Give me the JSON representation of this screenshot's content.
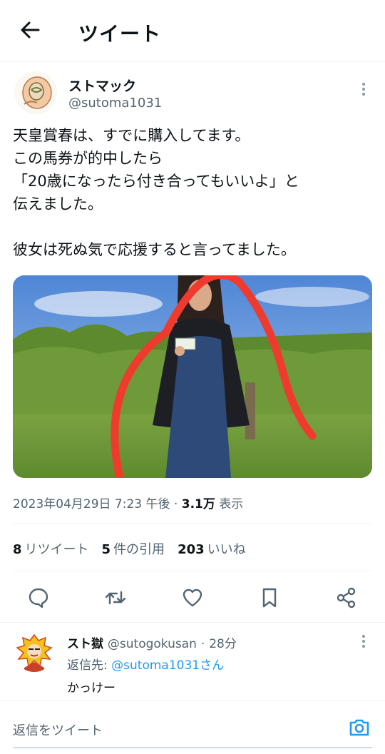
{
  "header": {
    "title": "ツイート"
  },
  "tweet": {
    "display_name": "ストマック",
    "handle": "@sutoma1031",
    "text": "天皇賞春は、すでに購入してます。\nこの馬券が的中したら\n「20歳になったら付き合ってもいいよ」と\n伝えました。\n\n彼女は死ぬ気で応援すると言ってました。",
    "timestamp": "2023年04月29日 7:23 午後",
    "views_count": "3.1万",
    "views_label": "表示",
    "retweets_count": "8",
    "retweets_label": "リツイート",
    "quotes_count": "5",
    "quotes_label": "件の引用",
    "likes_count": "203",
    "likes_label": "いいね"
  },
  "reply": {
    "display_name": "スト獄",
    "handle": "@sutogokusan",
    "time": "28分",
    "reply_to_label": "返信先:",
    "reply_to_handle": "@sutoma1031さん",
    "text": "かっけー"
  },
  "composer": {
    "placeholder": "返信をツイート"
  },
  "icons": [
    "back-arrow-icon",
    "more-icon",
    "reply-icon",
    "retweet-icon",
    "like-icon",
    "bookmark-icon",
    "share-icon",
    "camera-icon"
  ],
  "colors": {
    "accent": "#1d9bf0",
    "secondary_text": "#536471",
    "divider": "#eff3f4",
    "scribble": "#ef3b2e"
  }
}
